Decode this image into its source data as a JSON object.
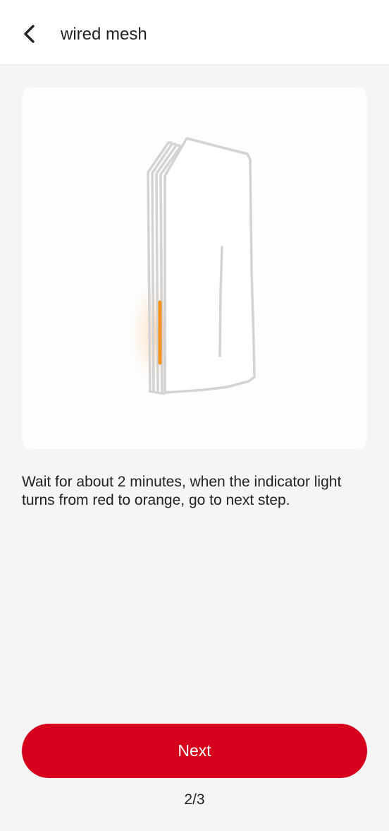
{
  "header": {
    "back_icon": "chevron-left-icon",
    "title": "wired mesh"
  },
  "illustration": {
    "subject": "mesh-router-icon",
    "indicator_color": "#f7931e",
    "glow_color": "#ffb066"
  },
  "instruction": {
    "text": "Wait for about 2 minutes, when the indicator light turns from red to orange, go to next step."
  },
  "actions": {
    "next_label": "Next",
    "accent_color": "#d6001c"
  },
  "progress": {
    "step_text": "2/3",
    "current": 2,
    "total": 3
  }
}
